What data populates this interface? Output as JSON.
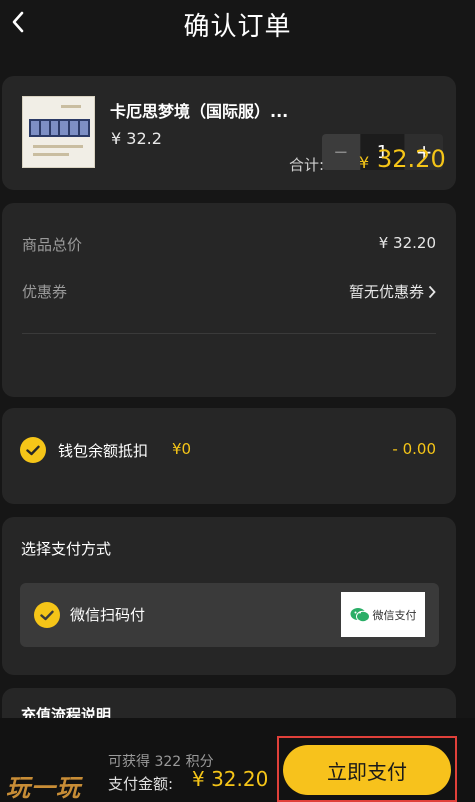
{
  "header": {
    "title": "确认订单",
    "back_icon": "chevron-left-icon"
  },
  "product": {
    "name": "卡厄思梦境（国际服）...",
    "price": "¥ 32.2",
    "quantity": "1",
    "minus_label": "−",
    "plus_label": "+"
  },
  "summary": {
    "total_label": "商品总价",
    "total_value": "¥ 32.20",
    "coupon_label": "优惠券",
    "coupon_value": "暂无优惠券",
    "subtotal_label": "合计:",
    "subtotal_symbol": "¥",
    "subtotal_value": "32.20"
  },
  "wallet": {
    "label": "钱包余额抵扣",
    "balance": "¥0",
    "deduction": "- 0.00",
    "checked": true
  },
  "payment": {
    "title": "选择支付方式",
    "option_label": "微信扫码付",
    "badge_text": "微信支付",
    "checked": true
  },
  "flow": {
    "title": "充值流程说明"
  },
  "footer": {
    "points": "可获得 322 积分",
    "amount_label": "支付金额:",
    "amount_value": "¥ 32.20",
    "pay_button": "立即支付",
    "watermark": "玩一玩"
  },
  "colors": {
    "accent": "#f5c518",
    "background": "#161616",
    "card": "#262626",
    "highlight_frame": "#e0403a"
  }
}
